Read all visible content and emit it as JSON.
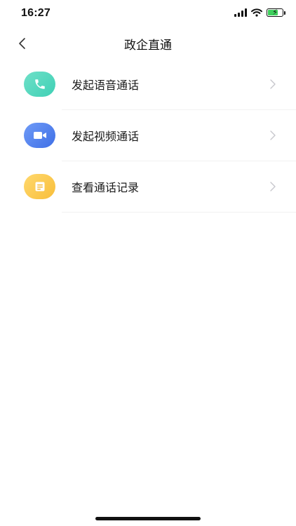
{
  "status_bar": {
    "time": "16:27",
    "battery_color": "#3ed05c",
    "charging_icon": "⚡"
  },
  "nav": {
    "title": "政企直通",
    "back_icon": "chevron-left-icon"
  },
  "menu": {
    "items": [
      {
        "label": "发起语音通话",
        "icon": "phone-icon",
        "gradient": [
          "#6fe0c8",
          "#3fd0b5"
        ]
      },
      {
        "label": "发起视频通话",
        "icon": "video-camera-icon",
        "gradient": [
          "#6f9bf7",
          "#3f6fe6"
        ]
      },
      {
        "label": "查看通话记录",
        "icon": "document-icon",
        "gradient": [
          "#ffd86d",
          "#f8be3a"
        ]
      }
    ]
  }
}
